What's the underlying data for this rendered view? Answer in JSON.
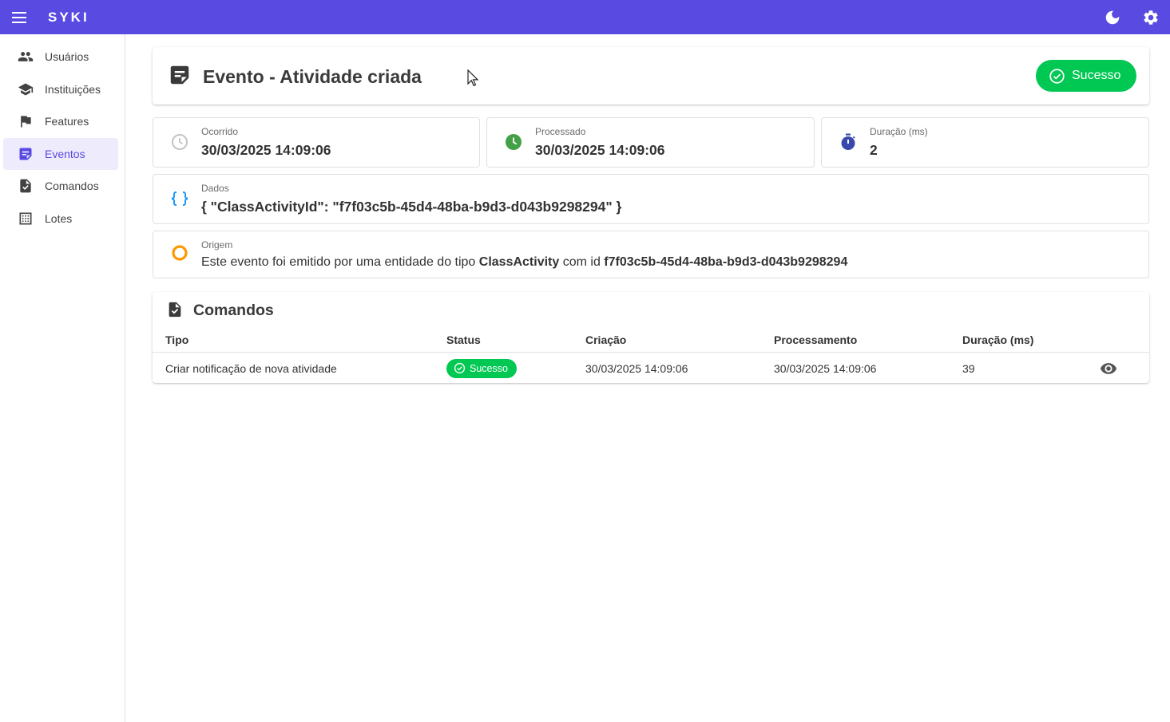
{
  "app": {
    "brand": "SYKI"
  },
  "sidebar": {
    "items": [
      {
        "label": "Usuários",
        "icon": "people-icon"
      },
      {
        "label": "Instituições",
        "icon": "school-icon"
      },
      {
        "label": "Features",
        "icon": "flag-icon"
      },
      {
        "label": "Eventos",
        "icon": "event-note-icon",
        "active": true
      },
      {
        "label": "Comandos",
        "icon": "task-icon"
      },
      {
        "label": "Lotes",
        "icon": "grid-dots-icon"
      }
    ]
  },
  "header": {
    "title": "Evento - Atividade criada",
    "status_label": "Sucesso",
    "status_color": "#00c853"
  },
  "info": {
    "occurred_label": "Ocorrido",
    "occurred_value": "30/03/2025 14:09:06",
    "processed_label": "Processado",
    "processed_value": "30/03/2025 14:09:06",
    "duration_label": "Duração (ms)",
    "duration_value": "2",
    "data_label": "Dados",
    "data_value": "{ \"ClassActivityId\": \"f7f03c5b-45d4-48ba-b9d3-d043b9298294\" }",
    "origin_label": "Origem",
    "origin_prefix": "Este evento foi emitido por uma entidade do tipo ",
    "origin_entity": "ClassActivity",
    "origin_mid": " com id ",
    "origin_id": "f7f03c5b-45d4-48ba-b9d3-d043b9298294"
  },
  "commands": {
    "title": "Comandos",
    "columns": [
      "Tipo",
      "Status",
      "Criação",
      "Processamento",
      "Duração (ms)"
    ],
    "rows": [
      {
        "tipo": "Criar notificação de nova atividade",
        "status": "Sucesso",
        "criacao": "30/03/2025 14:09:06",
        "processamento": "30/03/2025 14:09:06",
        "duracao": "39"
      }
    ]
  },
  "colors": {
    "primary": "#594ae2",
    "success": "#00c853",
    "processed_icon": "#43a047",
    "duration_icon": "#3949ab",
    "data_icon": "#2196f3",
    "origin_icon": "#ff9800"
  }
}
